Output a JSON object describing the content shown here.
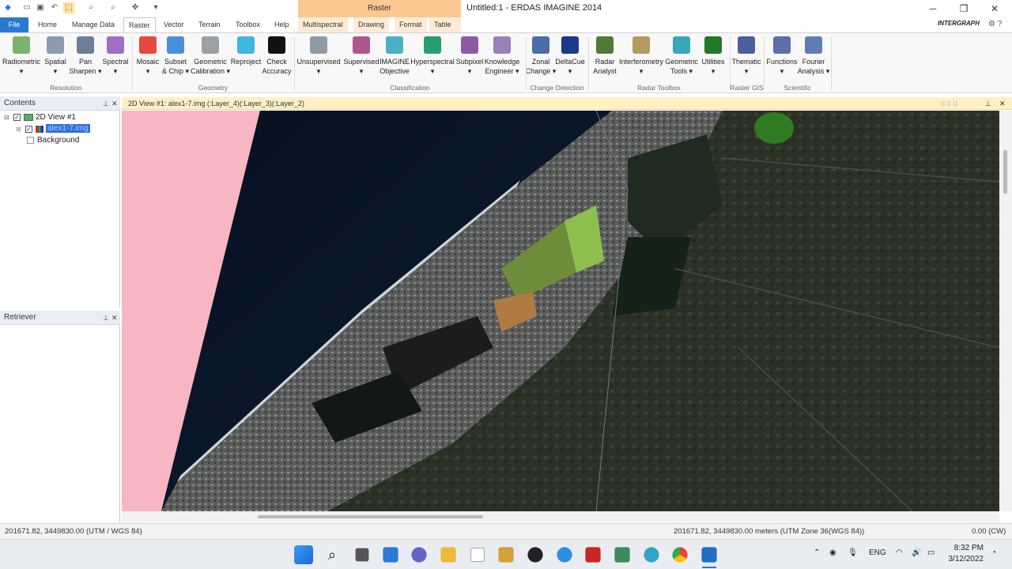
{
  "window": {
    "title": "Untitled:1 - ERDAS IMAGINE 2014",
    "context_tab": "Raster",
    "controls": [
      "─",
      "❐",
      "✕"
    ]
  },
  "brand": "INTERGRAPH",
  "tabs": [
    "File",
    "Home",
    "Manage Data",
    "Raster",
    "Vector",
    "Terrain",
    "Toolbox",
    "Help",
    "Multispectral",
    "Drawing",
    "Format",
    "Table"
  ],
  "ribbon": {
    "buttons": [
      {
        "l1": "Radiometric",
        "l2": "▾"
      },
      {
        "l1": "Spatial",
        "l2": "▾"
      },
      {
        "l1": "Pan",
        "l2": "Sharpen ▾"
      },
      {
        "l1": "Spectral",
        "l2": "▾"
      },
      {
        "l1": "Mosaic",
        "l2": "▾"
      },
      {
        "l1": "Subset",
        "l2": "& Chip ▾"
      },
      {
        "l1": "Geometric",
        "l2": "Calibration ▾"
      },
      {
        "l1": "Reproject",
        "l2": ""
      },
      {
        "l1": "Check",
        "l2": "Accuracy"
      },
      {
        "l1": "Unsupervised",
        "l2": "▾"
      },
      {
        "l1": "Supervised",
        "l2": "▾"
      },
      {
        "l1": "IMAGINE",
        "l2": "Objective"
      },
      {
        "l1": "Hyperspectral",
        "l2": "▾"
      },
      {
        "l1": "Subpixel",
        "l2": "▾"
      },
      {
        "l1": "Knowledge",
        "l2": "Engineer ▾"
      },
      {
        "l1": "Zonal",
        "l2": "Change ▾"
      },
      {
        "l1": "DeltaCue",
        "l2": "▾"
      },
      {
        "l1": "Radar",
        "l2": "Analyst"
      },
      {
        "l1": "Interferometry",
        "l2": "▾"
      },
      {
        "l1": "Geometric",
        "l2": "Tools ▾"
      },
      {
        "l1": "Utilities",
        "l2": "▾"
      },
      {
        "l1": "Thematic",
        "l2": "▾"
      },
      {
        "l1": "Functions",
        "l2": "▾"
      },
      {
        "l1": "Fourier",
        "l2": "Analysis ▾"
      }
    ],
    "groups": [
      "Resolution",
      "Geometry",
      "Classification",
      "Change Detection",
      "Radar Toolbox",
      "Raster GIS",
      "Scientific"
    ],
    "icon_colors": [
      "#7cb36a",
      "#8a9bb0",
      "#6b7f96",
      "#a06fc2",
      "#e8483d",
      "#4a90d9",
      "#9aa0a6",
      "#3fb7e0",
      "#111111",
      "#8f9aa6",
      "#b0568e",
      "#4ab0c8",
      "#2a9d6e",
      "#8d5aa8",
      "#9a7fb8",
      "#4a6fa5",
      "#1c3a8a",
      "#4f7a3a",
      "#b59a5e",
      "#3aa6b9",
      "#1f7a2a",
      "#4a5fa0",
      "#5b6fa8",
      "#5d7fb0"
    ]
  },
  "contents": {
    "title": "Contents",
    "view": "2D View #1",
    "layer": "alex1-7.img",
    "background": "Background"
  },
  "retriever": {
    "title": "Retriever"
  },
  "view": {
    "title": "2D View #1: alex1-7.img (:Layer_4)(:Layer_3)(:Layer_2)"
  },
  "status": {
    "left": "201671.82, 3449830.00  (UTM / WGS 84)",
    "right": "201671.82, 3449830.00 meters (UTM Zone 36(WGS 84))",
    "rotation": "0.00 (CW)"
  },
  "tray": {
    "lang": "ENG",
    "time": "8:32 PM",
    "date": "3/12/2022"
  }
}
